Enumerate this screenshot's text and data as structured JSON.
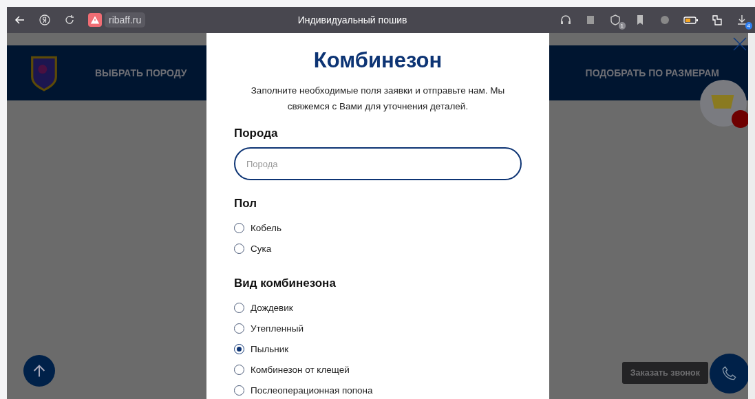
{
  "browser": {
    "url": "ribaff.ru",
    "title": "Индивидуальный пошив",
    "shield_badge": "1",
    "downloads_badge": "4"
  },
  "site_nav": {
    "items": [
      "ВЫБРАТЬ ПОРОДУ",
      "ПОДОБРАТЬ ПО РАЗМЕРАМ"
    ]
  },
  "modal": {
    "title": "Комбинезон",
    "intro": "Заполните необходимые поля заявки и отправьте нам. Мы свяжемся с Вами для уточнения деталей.",
    "breed": {
      "label": "Порода",
      "placeholder": "Порода"
    },
    "groups": [
      {
        "label": "Пол",
        "options": [
          {
            "label": "Кобель",
            "selected": false
          },
          {
            "label": "Сука",
            "selected": false
          }
        ]
      },
      {
        "label": "Вид комбинезона",
        "options": [
          {
            "label": "Дождевик",
            "selected": false
          },
          {
            "label": "Утепленный",
            "selected": false
          },
          {
            "label": "Пыльник",
            "selected": true
          },
          {
            "label": "Комбинезон от клещей",
            "selected": false
          },
          {
            "label": "Послеоперационная попона",
            "selected": false
          }
        ]
      }
    ]
  },
  "callback": {
    "label": "Заказать звонок"
  }
}
